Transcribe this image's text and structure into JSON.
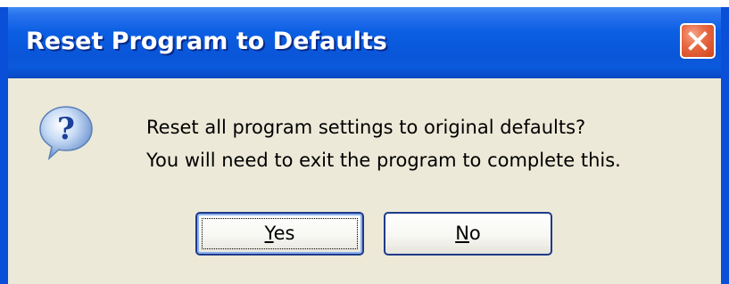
{
  "dialog": {
    "title": "Reset Program to Defaults",
    "close_label": "X",
    "icon": "question-icon",
    "icon_symbol": "?",
    "message_line1": "Reset all program settings to original defaults?",
    "message_line2": "You will need to exit the program to complete this.",
    "buttons": {
      "yes": {
        "mnemonic": "Y",
        "rest": "es"
      },
      "no": {
        "mnemonic": "N",
        "rest": "o"
      }
    }
  },
  "colors": {
    "titlebar": "#0a56d9",
    "frame": "#0a4fd8",
    "body": "#ece9d8",
    "close": "#e05a30"
  }
}
